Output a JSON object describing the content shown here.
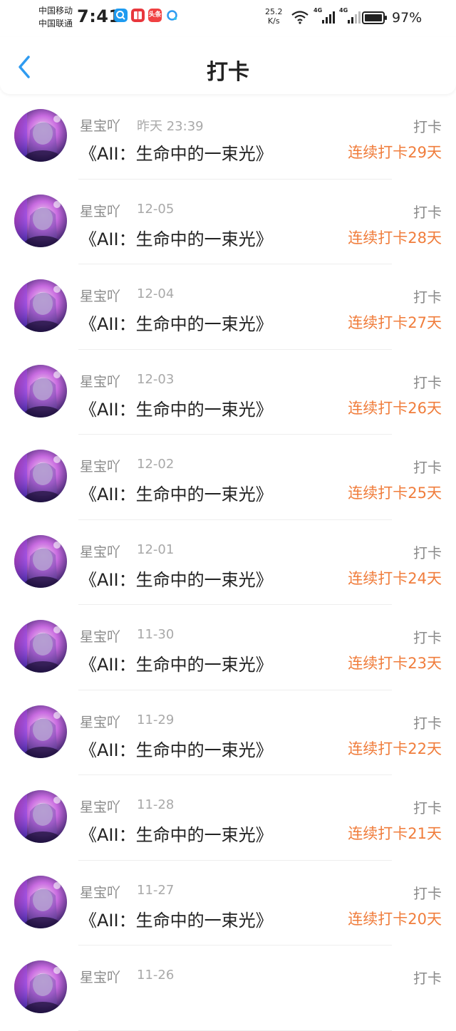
{
  "status_bar": {
    "carrier_1": "中国移动",
    "carrier_2": "中国联通",
    "time": "7:41",
    "speed_value": "25.2",
    "speed_unit": "K/s",
    "network_1": "4G",
    "network_2": "4G",
    "battery": "97%",
    "app_badge": "头条"
  },
  "header": {
    "title": "打卡"
  },
  "entries": [
    {
      "user": "星宝吖",
      "time": "昨天 23:39",
      "book": "《AII：生命中的一束光》",
      "type": "打卡",
      "streak": "连续打卡29天"
    },
    {
      "user": "星宝吖",
      "time": "12-05",
      "book": "《AII：生命中的一束光》",
      "type": "打卡",
      "streak": "连续打卡28天"
    },
    {
      "user": "星宝吖",
      "time": "12-04",
      "book": "《AII：生命中的一束光》",
      "type": "打卡",
      "streak": "连续打卡27天"
    },
    {
      "user": "星宝吖",
      "time": "12-03",
      "book": "《AII：生命中的一束光》",
      "type": "打卡",
      "streak": "连续打卡26天"
    },
    {
      "user": "星宝吖",
      "time": "12-02",
      "book": "《AII：生命中的一束光》",
      "type": "打卡",
      "streak": "连续打卡25天"
    },
    {
      "user": "星宝吖",
      "time": "12-01",
      "book": "《AII：生命中的一束光》",
      "type": "打卡",
      "streak": "连续打卡24天"
    },
    {
      "user": "星宝吖",
      "time": "11-30",
      "book": "《AII：生命中的一束光》",
      "type": "打卡",
      "streak": "连续打卡23天"
    },
    {
      "user": "星宝吖",
      "time": "11-29",
      "book": "《AII：生命中的一束光》",
      "type": "打卡",
      "streak": "连续打卡22天"
    },
    {
      "user": "星宝吖",
      "time": "11-28",
      "book": "《AII：生命中的一束光》",
      "type": "打卡",
      "streak": "连续打卡21天"
    },
    {
      "user": "星宝吖",
      "time": "11-27",
      "book": "《AII：生命中的一束光》",
      "type": "打卡",
      "streak": "连续打卡20天"
    },
    {
      "user": "星宝吖",
      "time": "11-26",
      "book": "",
      "type": "打卡",
      "streak": ""
    }
  ],
  "colors": {
    "accent_back": "#2f9bf0",
    "streak": "#f07d3c"
  }
}
